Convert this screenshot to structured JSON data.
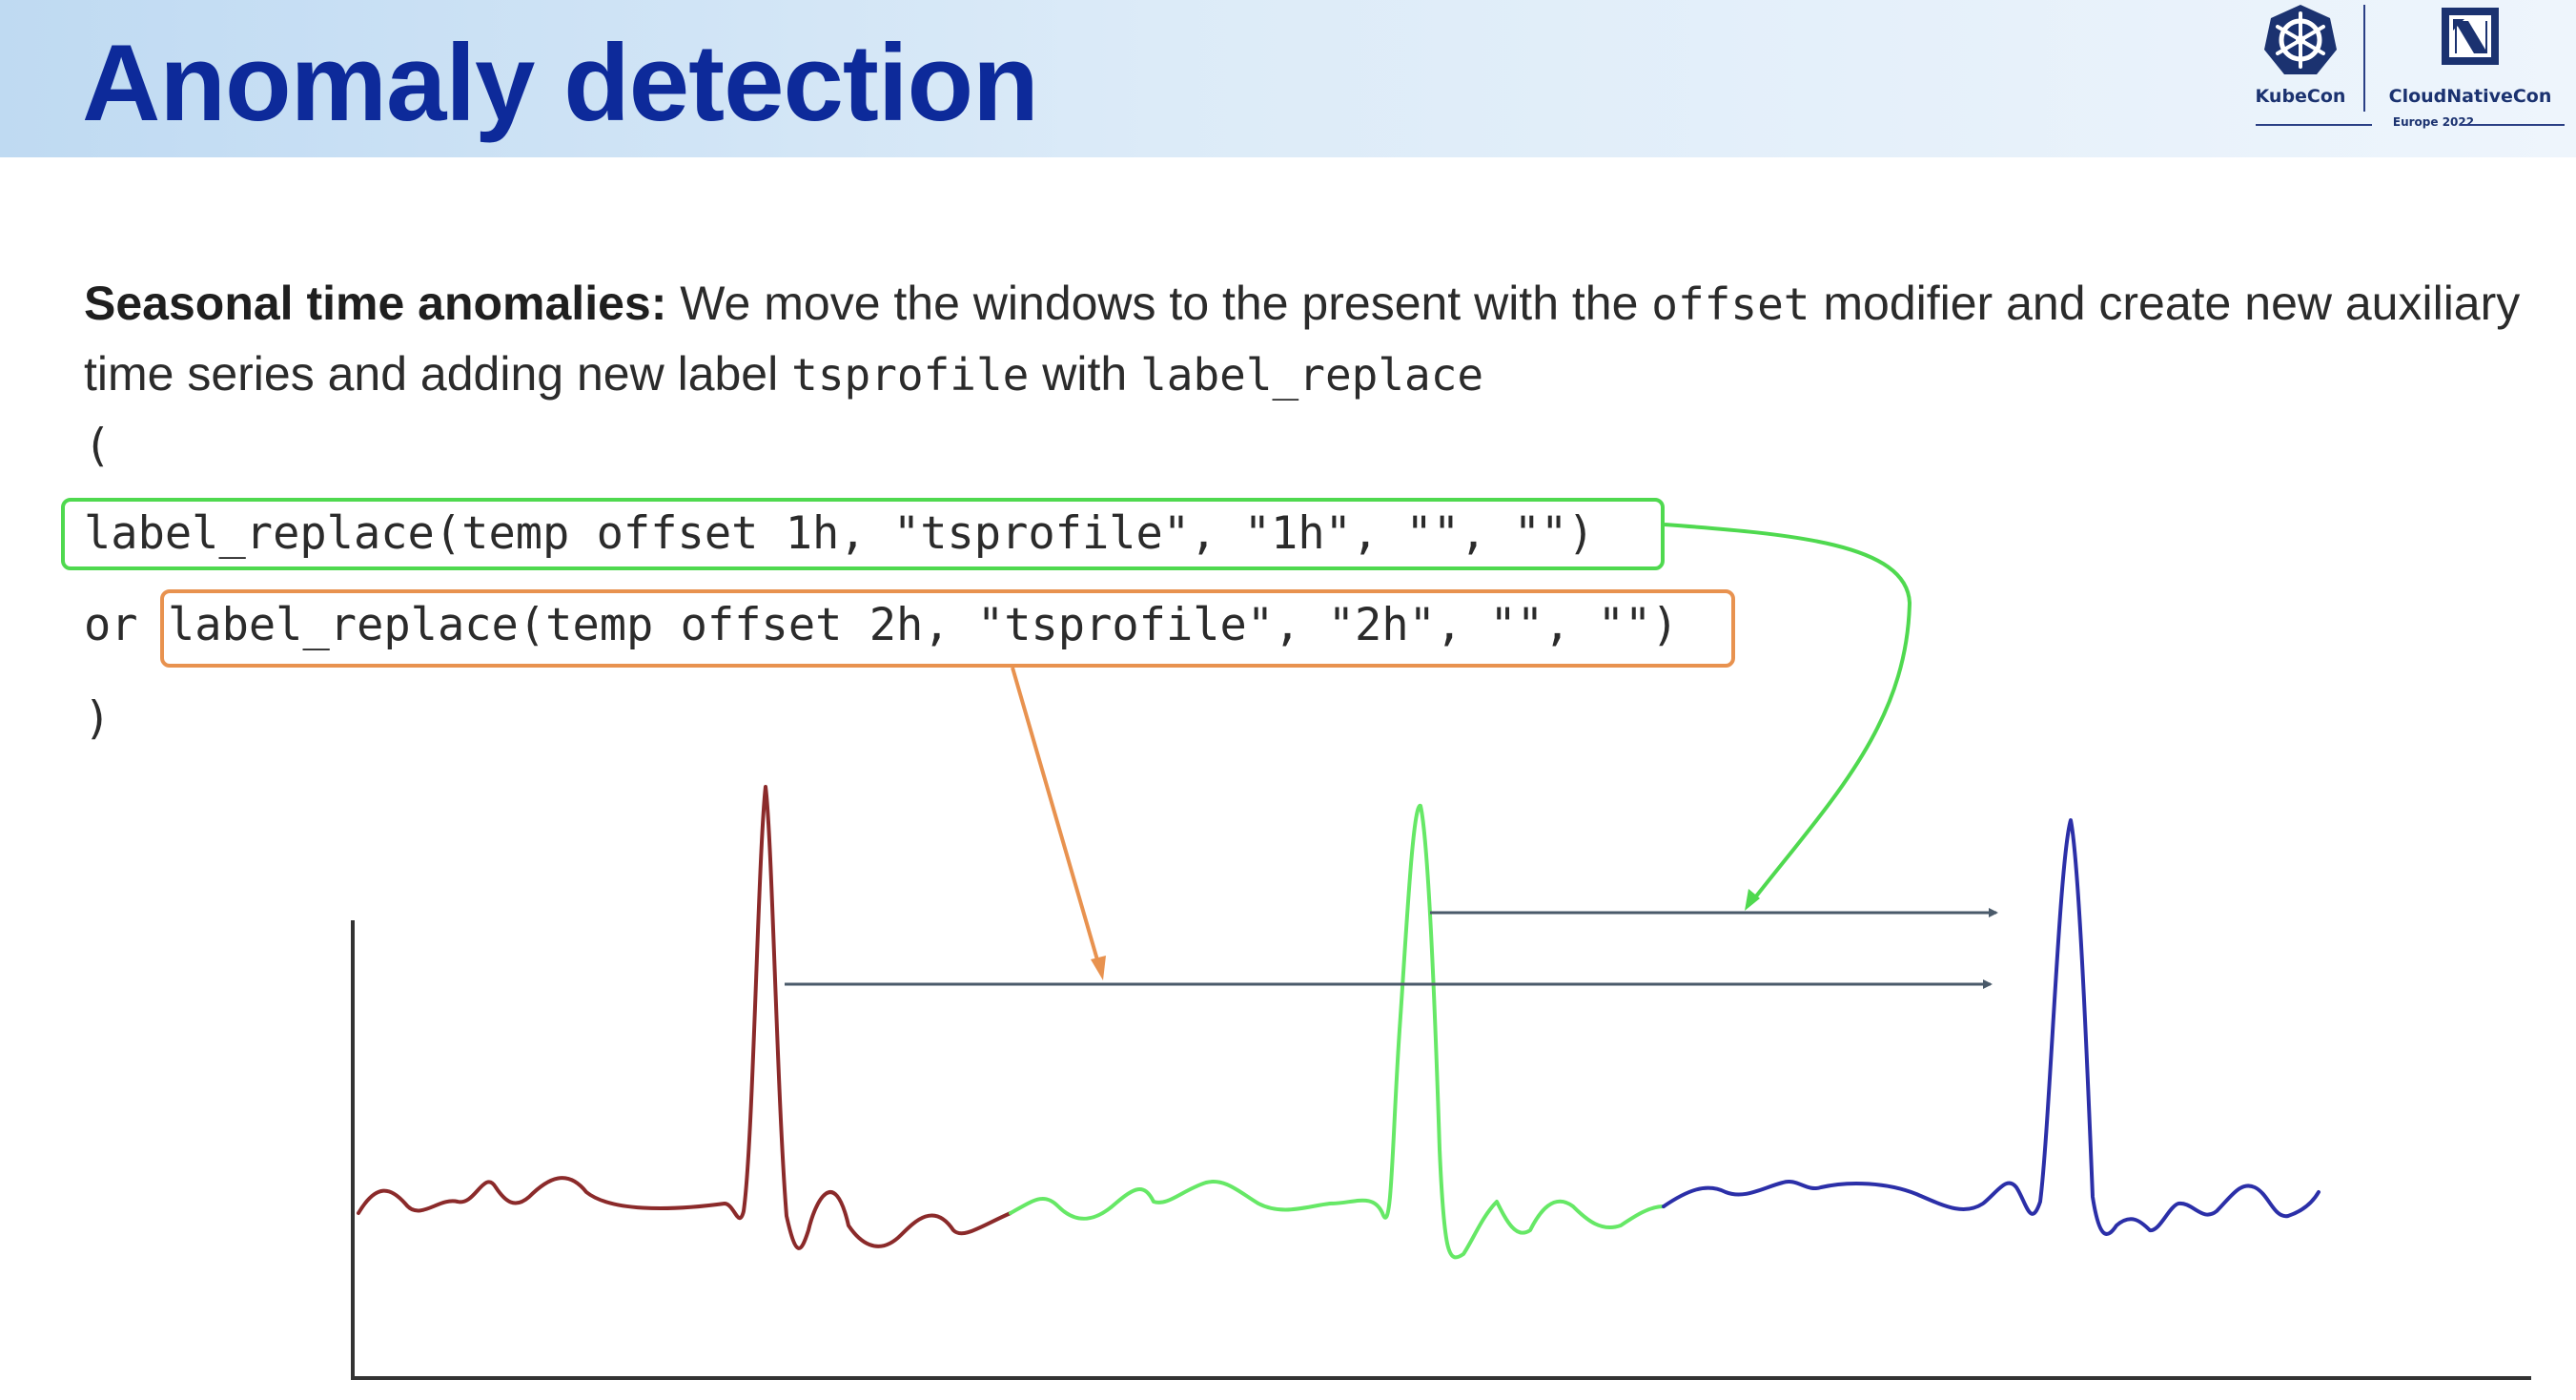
{
  "slide": {
    "title": "Anomaly detection",
    "logos": {
      "kubecon": "KubeCon",
      "cloudnativecon": "CloudNativeCon",
      "event": "Europe 2022",
      "kubecon_icon": "helm-wheel-icon",
      "cncf_icon": "cncf-square-icon"
    },
    "paragraph": {
      "lead": "Seasonal time anomalies:",
      "t1": " We move the windows to the present with the ",
      "c1": "offset",
      "t2": " modifier and create new auxiliary time series and adding new label ",
      "c2": "tsprofile",
      "t3": " with ",
      "c3": "label_replace"
    },
    "code": {
      "open": "(",
      "line1": "label_replace(temp offset 1h, \"tsprofile\", \"1h\", \"\", \"\")",
      "or": "or",
      "line2": "label_replace(temp offset 2h, \"tsprofile\", \"2h\", \"\", \"\")",
      "close": ")"
    },
    "colors": {
      "title": "#0d2a9a",
      "green": "#4fd94f",
      "orange": "#e8924f",
      "series_red": "#8b2a2a",
      "series_green": "#66e866",
      "series_blue": "#2b2fa8",
      "arrow_gray": "#4a5a6a"
    }
  }
}
